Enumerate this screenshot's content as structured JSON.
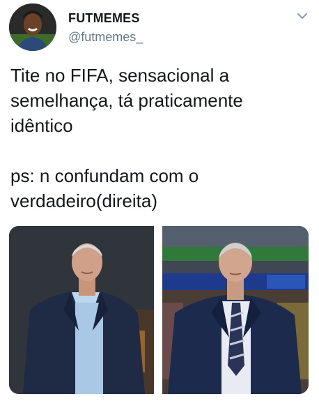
{
  "header": {
    "display_name": "FUTMEMES",
    "handle": "@futmemes_",
    "avatar_icon": "profile-photo",
    "menu_icon": "chevron-down-icon"
  },
  "tweet": {
    "text": "Tite no FIFA, sensacional a\nsemelhança, tá praticamente\nidêntico\n\nps: n confundam com o\nverdadeiro(direita)"
  },
  "media": {
    "left_image": "photo-real-coach",
    "right_image": "photo-fifa-coach"
  },
  "colors": {
    "text": "#14171a",
    "secondary_text": "#657786",
    "chevron": "#8899a6"
  }
}
